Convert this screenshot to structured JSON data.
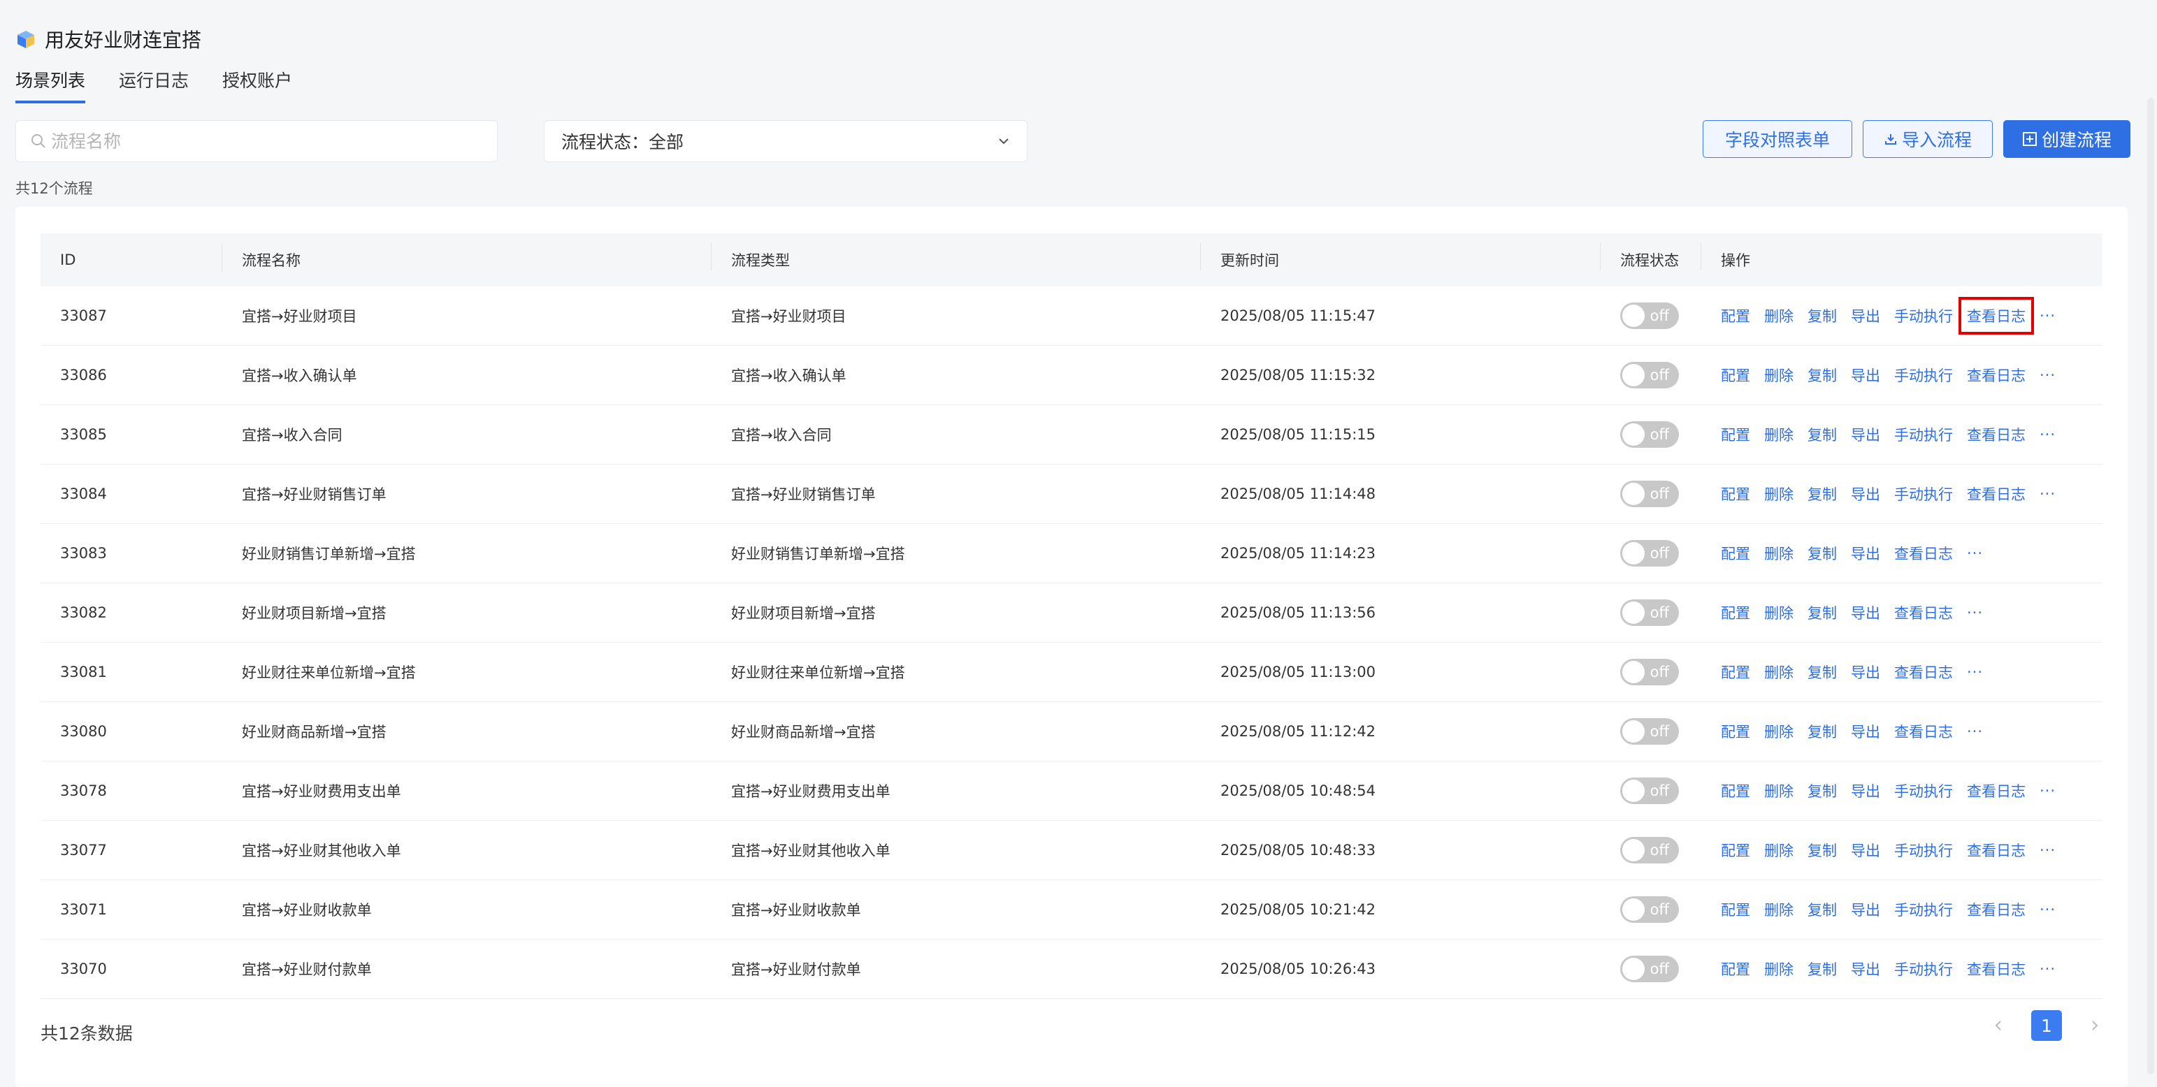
{
  "app": {
    "title": "用友好业财连宜搭",
    "logo_icon": "cube-logo-icon"
  },
  "tabs": [
    {
      "label": "场景列表",
      "active": true
    },
    {
      "label": "运行日志",
      "active": false
    },
    {
      "label": "授权账户",
      "active": false
    }
  ],
  "search": {
    "placeholder": "流程名称",
    "value": ""
  },
  "status_filter": {
    "label": "流程状态：全部"
  },
  "buttons": {
    "field_map": "字段对照表单",
    "import": "导入流程",
    "create": "创建流程"
  },
  "summary": {
    "count_text": "共12个流程"
  },
  "table": {
    "headers": [
      "ID",
      "流程名称",
      "流程类型",
      "更新时间",
      "流程状态",
      "操作"
    ],
    "rows": [
      {
        "id": "33087",
        "name": "宜搭→好业财项目",
        "type": "宜搭→好业财项目",
        "time": "2025/08/05 11:15:47",
        "status": "off",
        "ops": [
          "配置",
          "删除",
          "复制",
          "导出",
          "手动执行",
          "查看日志"
        ],
        "highlight": "查看日志"
      },
      {
        "id": "33086",
        "name": "宜搭→收入确认单",
        "type": "宜搭→收入确认单",
        "time": "2025/08/05 11:15:32",
        "status": "off",
        "ops": [
          "配置",
          "删除",
          "复制",
          "导出",
          "手动执行",
          "查看日志"
        ]
      },
      {
        "id": "33085",
        "name": "宜搭→收入合同",
        "type": "宜搭→收入合同",
        "time": "2025/08/05 11:15:15",
        "status": "off",
        "ops": [
          "配置",
          "删除",
          "复制",
          "导出",
          "手动执行",
          "查看日志"
        ]
      },
      {
        "id": "33084",
        "name": "宜搭→好业财销售订单",
        "type": "宜搭→好业财销售订单",
        "time": "2025/08/05 11:14:48",
        "status": "off",
        "ops": [
          "配置",
          "删除",
          "复制",
          "导出",
          "手动执行",
          "查看日志"
        ]
      },
      {
        "id": "33083",
        "name": "好业财销售订单新增→宜搭",
        "type": "好业财销售订单新增→宜搭",
        "time": "2025/08/05 11:14:23",
        "status": "off",
        "ops": [
          "配置",
          "删除",
          "复制",
          "导出",
          "查看日志"
        ]
      },
      {
        "id": "33082",
        "name": "好业财项目新增→宜搭",
        "type": "好业财项目新增→宜搭",
        "time": "2025/08/05 11:13:56",
        "status": "off",
        "ops": [
          "配置",
          "删除",
          "复制",
          "导出",
          "查看日志"
        ]
      },
      {
        "id": "33081",
        "name": "好业财往来单位新增→宜搭",
        "type": "好业财往来单位新增→宜搭",
        "time": "2025/08/05 11:13:00",
        "status": "off",
        "ops": [
          "配置",
          "删除",
          "复制",
          "导出",
          "查看日志"
        ]
      },
      {
        "id": "33080",
        "name": "好业财商品新增→宜搭",
        "type": "好业财商品新增→宜搭",
        "time": "2025/08/05 11:12:42",
        "status": "off",
        "ops": [
          "配置",
          "删除",
          "复制",
          "导出",
          "查看日志"
        ]
      },
      {
        "id": "33078",
        "name": "宜搭→好业财费用支出单",
        "type": "宜搭→好业财费用支出单",
        "time": "2025/08/05 10:48:54",
        "status": "off",
        "ops": [
          "配置",
          "删除",
          "复制",
          "导出",
          "手动执行",
          "查看日志"
        ]
      },
      {
        "id": "33077",
        "name": "宜搭→好业财其他收入单",
        "type": "宜搭→好业财其他收入单",
        "time": "2025/08/05 10:48:33",
        "status": "off",
        "ops": [
          "配置",
          "删除",
          "复制",
          "导出",
          "手动执行",
          "查看日志"
        ]
      },
      {
        "id": "33071",
        "name": "宜搭→好业财收款单",
        "type": "宜搭→好业财收款单",
        "time": "2025/08/05 10:21:42",
        "status": "off",
        "ops": [
          "配置",
          "删除",
          "复制",
          "导出",
          "手动执行",
          "查看日志"
        ]
      },
      {
        "id": "33070",
        "name": "宜搭→好业财付款单",
        "type": "宜搭→好业财付款单",
        "time": "2025/08/05 10:26:43",
        "status": "off",
        "ops": [
          "配置",
          "删除",
          "复制",
          "导出",
          "手动执行",
          "查看日志"
        ]
      }
    ],
    "more_label": "···"
  },
  "footer": {
    "total_text": "共12条数据",
    "current_page": "1"
  },
  "colors": {
    "accent": "#2f6fe4",
    "highlight_border": "#e60000",
    "toggle_off": "#c8c8c8"
  }
}
